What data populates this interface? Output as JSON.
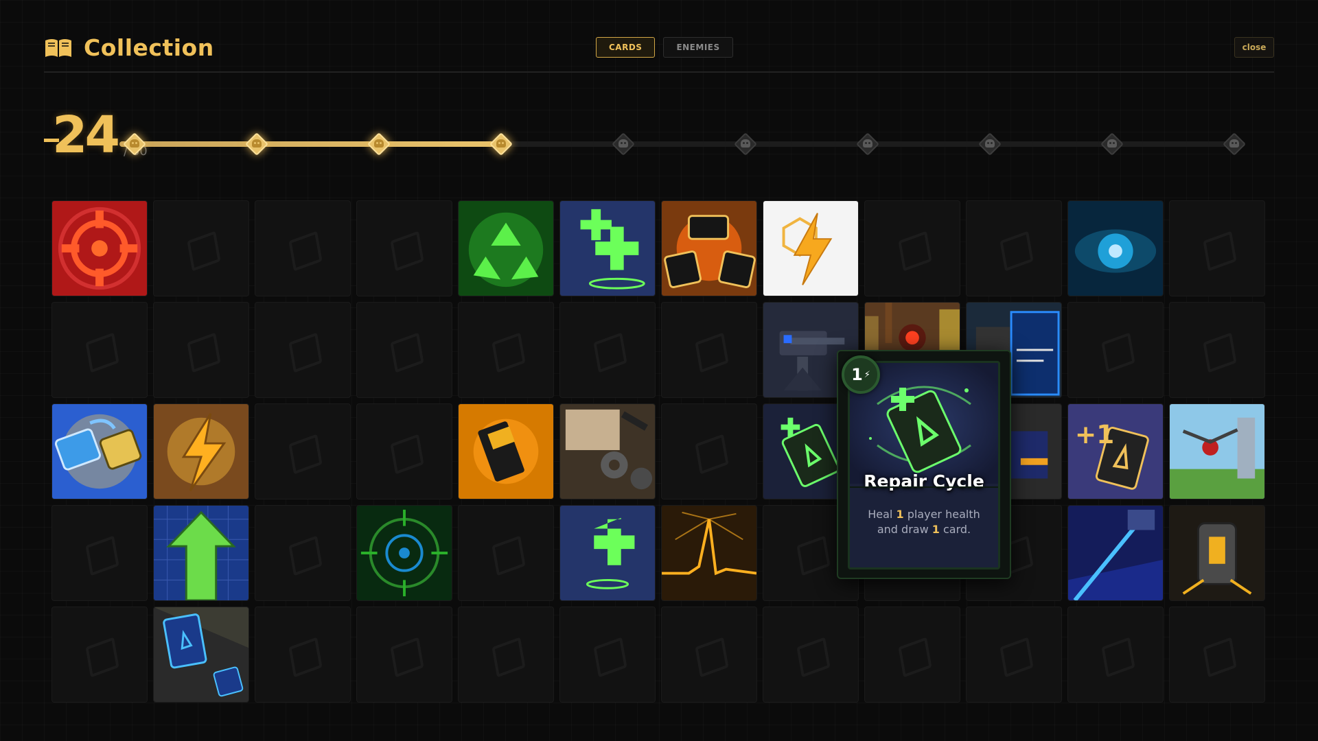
{
  "header": {
    "title": "Collection",
    "tabs": [
      {
        "label": "CARDS",
        "active": true
      },
      {
        "label": "ENEMIES",
        "active": false
      }
    ],
    "close_label": "close"
  },
  "progress": {
    "collected": "24",
    "total_label": "/ 60",
    "collected_value": 24,
    "total_value": 60,
    "milestones_total": 10,
    "milestones_reached": 4
  },
  "colors": {
    "accent": "#f0c15a",
    "background": "#0b0b0b",
    "slot_empty": "#121212",
    "tooltip_border": "#1f3b22"
  },
  "grid": {
    "rows": 5,
    "cols": 12,
    "slots": [
      "target-red-icon",
      "empty",
      "empty",
      "empty",
      "recycle-green-icon",
      "double-heal-icon",
      "card-burst-icon",
      "energy-white-icon",
      "empty",
      "empty",
      "eye-blue-icon",
      "empty",
      "empty",
      "empty",
      "empty",
      "empty",
      "empty",
      "empty",
      "empty",
      "turret-icon",
      "city-robot-icon",
      "blueprint-card-icon",
      "empty",
      "empty",
      "swap-cards-icon",
      "energy-gold-icon",
      "empty",
      "empty",
      "battery-icon",
      "workshop-tools-icon",
      "empty",
      "repair-cycle-icon",
      "blueprint-card-icon",
      "hidden-under-tooltip-icon",
      "plus-one-card-icon",
      "drone-landscape-icon",
      "empty",
      "upgrade-arrow-icon",
      "empty",
      "radar-green-icon",
      "empty",
      "heal-plus-icon",
      "pulse-spike-icon",
      "empty",
      "empty",
      "empty",
      "laser-turret-icon",
      "generator-icon",
      "empty",
      "discard-card-icon",
      "empty",
      "empty",
      "empty",
      "empty",
      "empty",
      "empty",
      "empty",
      "empty",
      "empty",
      "empty"
    ]
  },
  "tooltip": {
    "cost": "1",
    "cost_icon": "energy-bolt-icon",
    "name": "Repair Cycle",
    "desc_pre": "Heal ",
    "desc_num1": "1",
    "desc_mid": " player health and draw ",
    "desc_num2": "1",
    "desc_post": " card."
  }
}
